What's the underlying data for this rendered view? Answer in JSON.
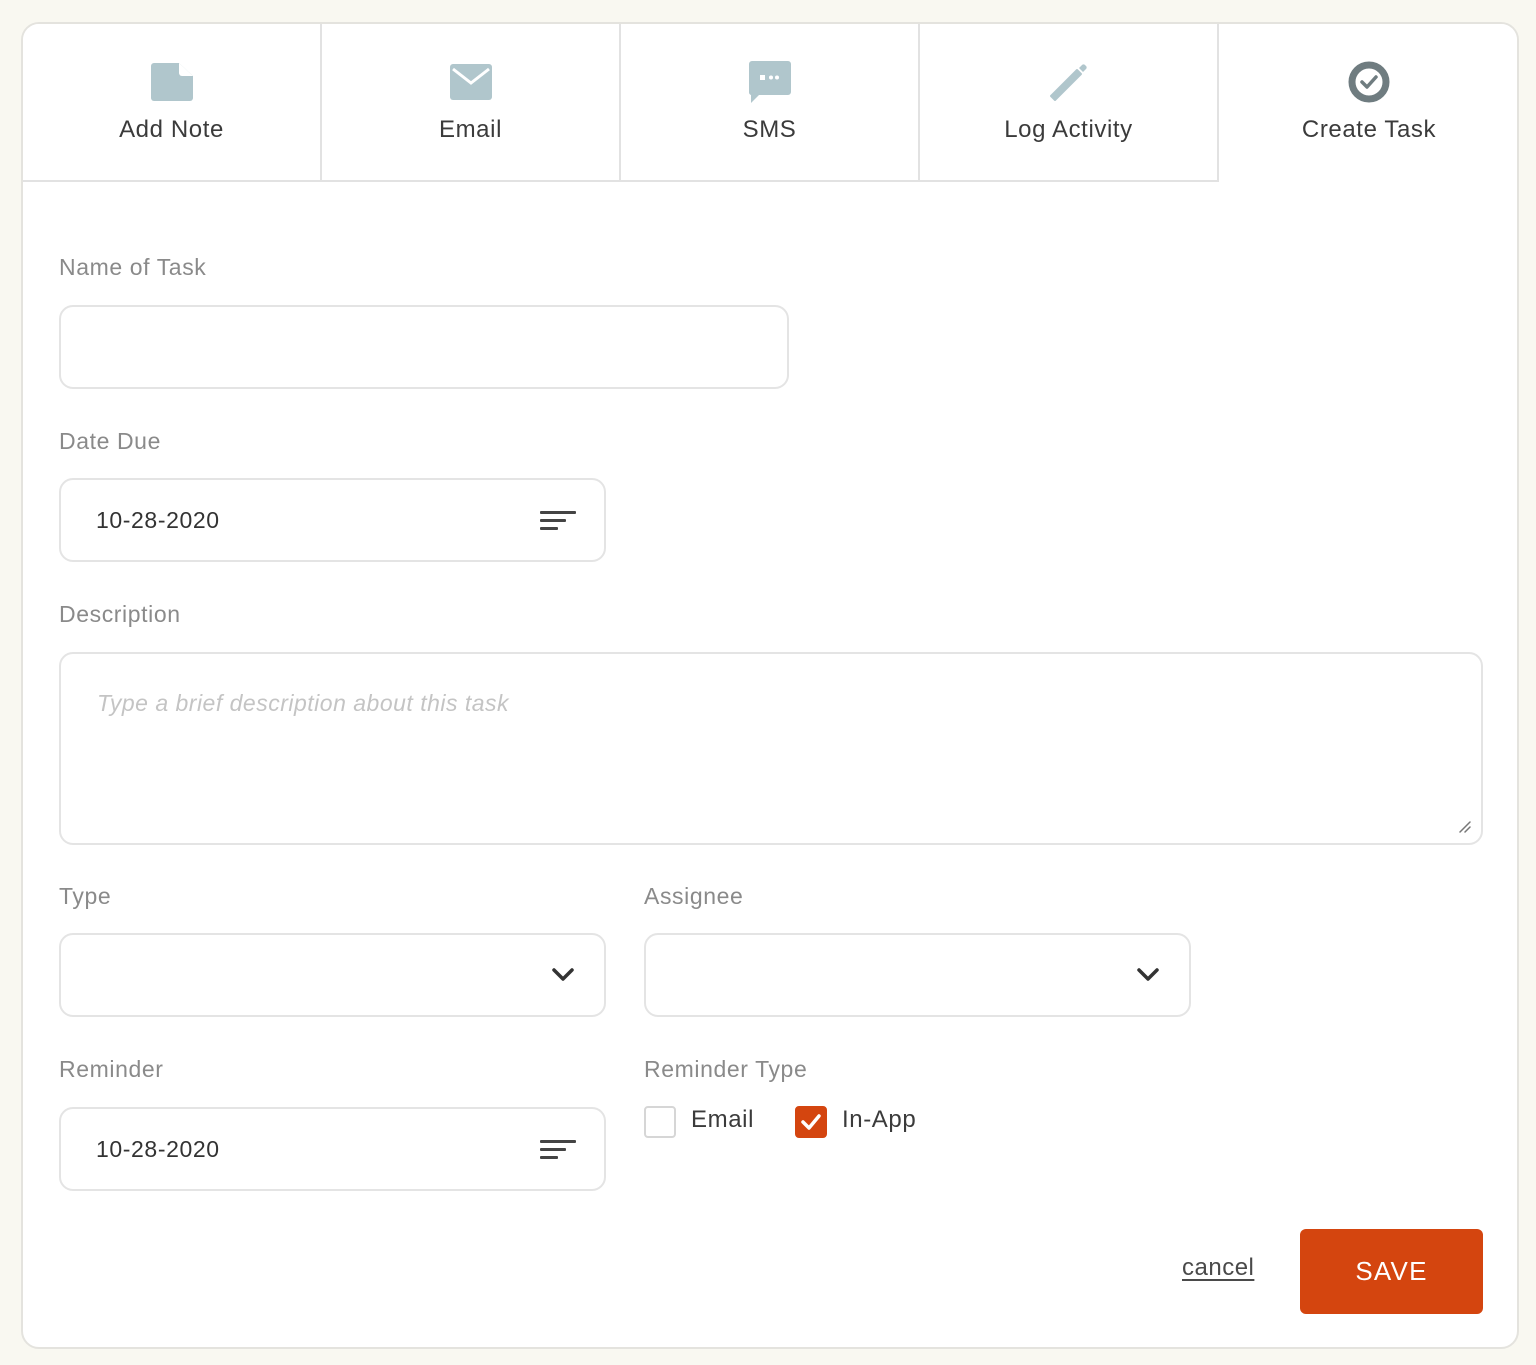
{
  "tabs": [
    {
      "label": "Add Note",
      "icon": "note-icon",
      "active": false
    },
    {
      "label": "Email",
      "icon": "envelope-icon",
      "active": false
    },
    {
      "label": "SMS",
      "icon": "chat-bubble-icon",
      "active": false
    },
    {
      "label": "Log Activity",
      "icon": "pencil-icon",
      "active": false
    },
    {
      "label": "Create Task",
      "icon": "check-circle-icon",
      "active": true
    }
  ],
  "form": {
    "name_of_task": {
      "label": "Name of Task",
      "value": ""
    },
    "date_due": {
      "label": "Date Due",
      "value": "10-28-2020",
      "icon": "calendar-lines-icon"
    },
    "description": {
      "label": "Description",
      "value": "",
      "placeholder": "Type a brief description about this task"
    },
    "type": {
      "label": "Type",
      "selected": ""
    },
    "assignee": {
      "label": "Assignee",
      "selected": ""
    },
    "reminder": {
      "label": "Reminder",
      "value": "10-28-2020",
      "icon": "calendar-lines-icon"
    },
    "reminder_type": {
      "label": "Reminder Type",
      "options": [
        {
          "label": "Email",
          "checked": false
        },
        {
          "label": "In-App",
          "checked": true
        }
      ]
    }
  },
  "actions": {
    "cancel_label": "cancel",
    "save_label": "SAVE"
  },
  "colors": {
    "accent": "#d4450f",
    "icon_muted": "#b0c6cc",
    "icon_active": "#6f7c80",
    "background": "#f9f8f1"
  }
}
